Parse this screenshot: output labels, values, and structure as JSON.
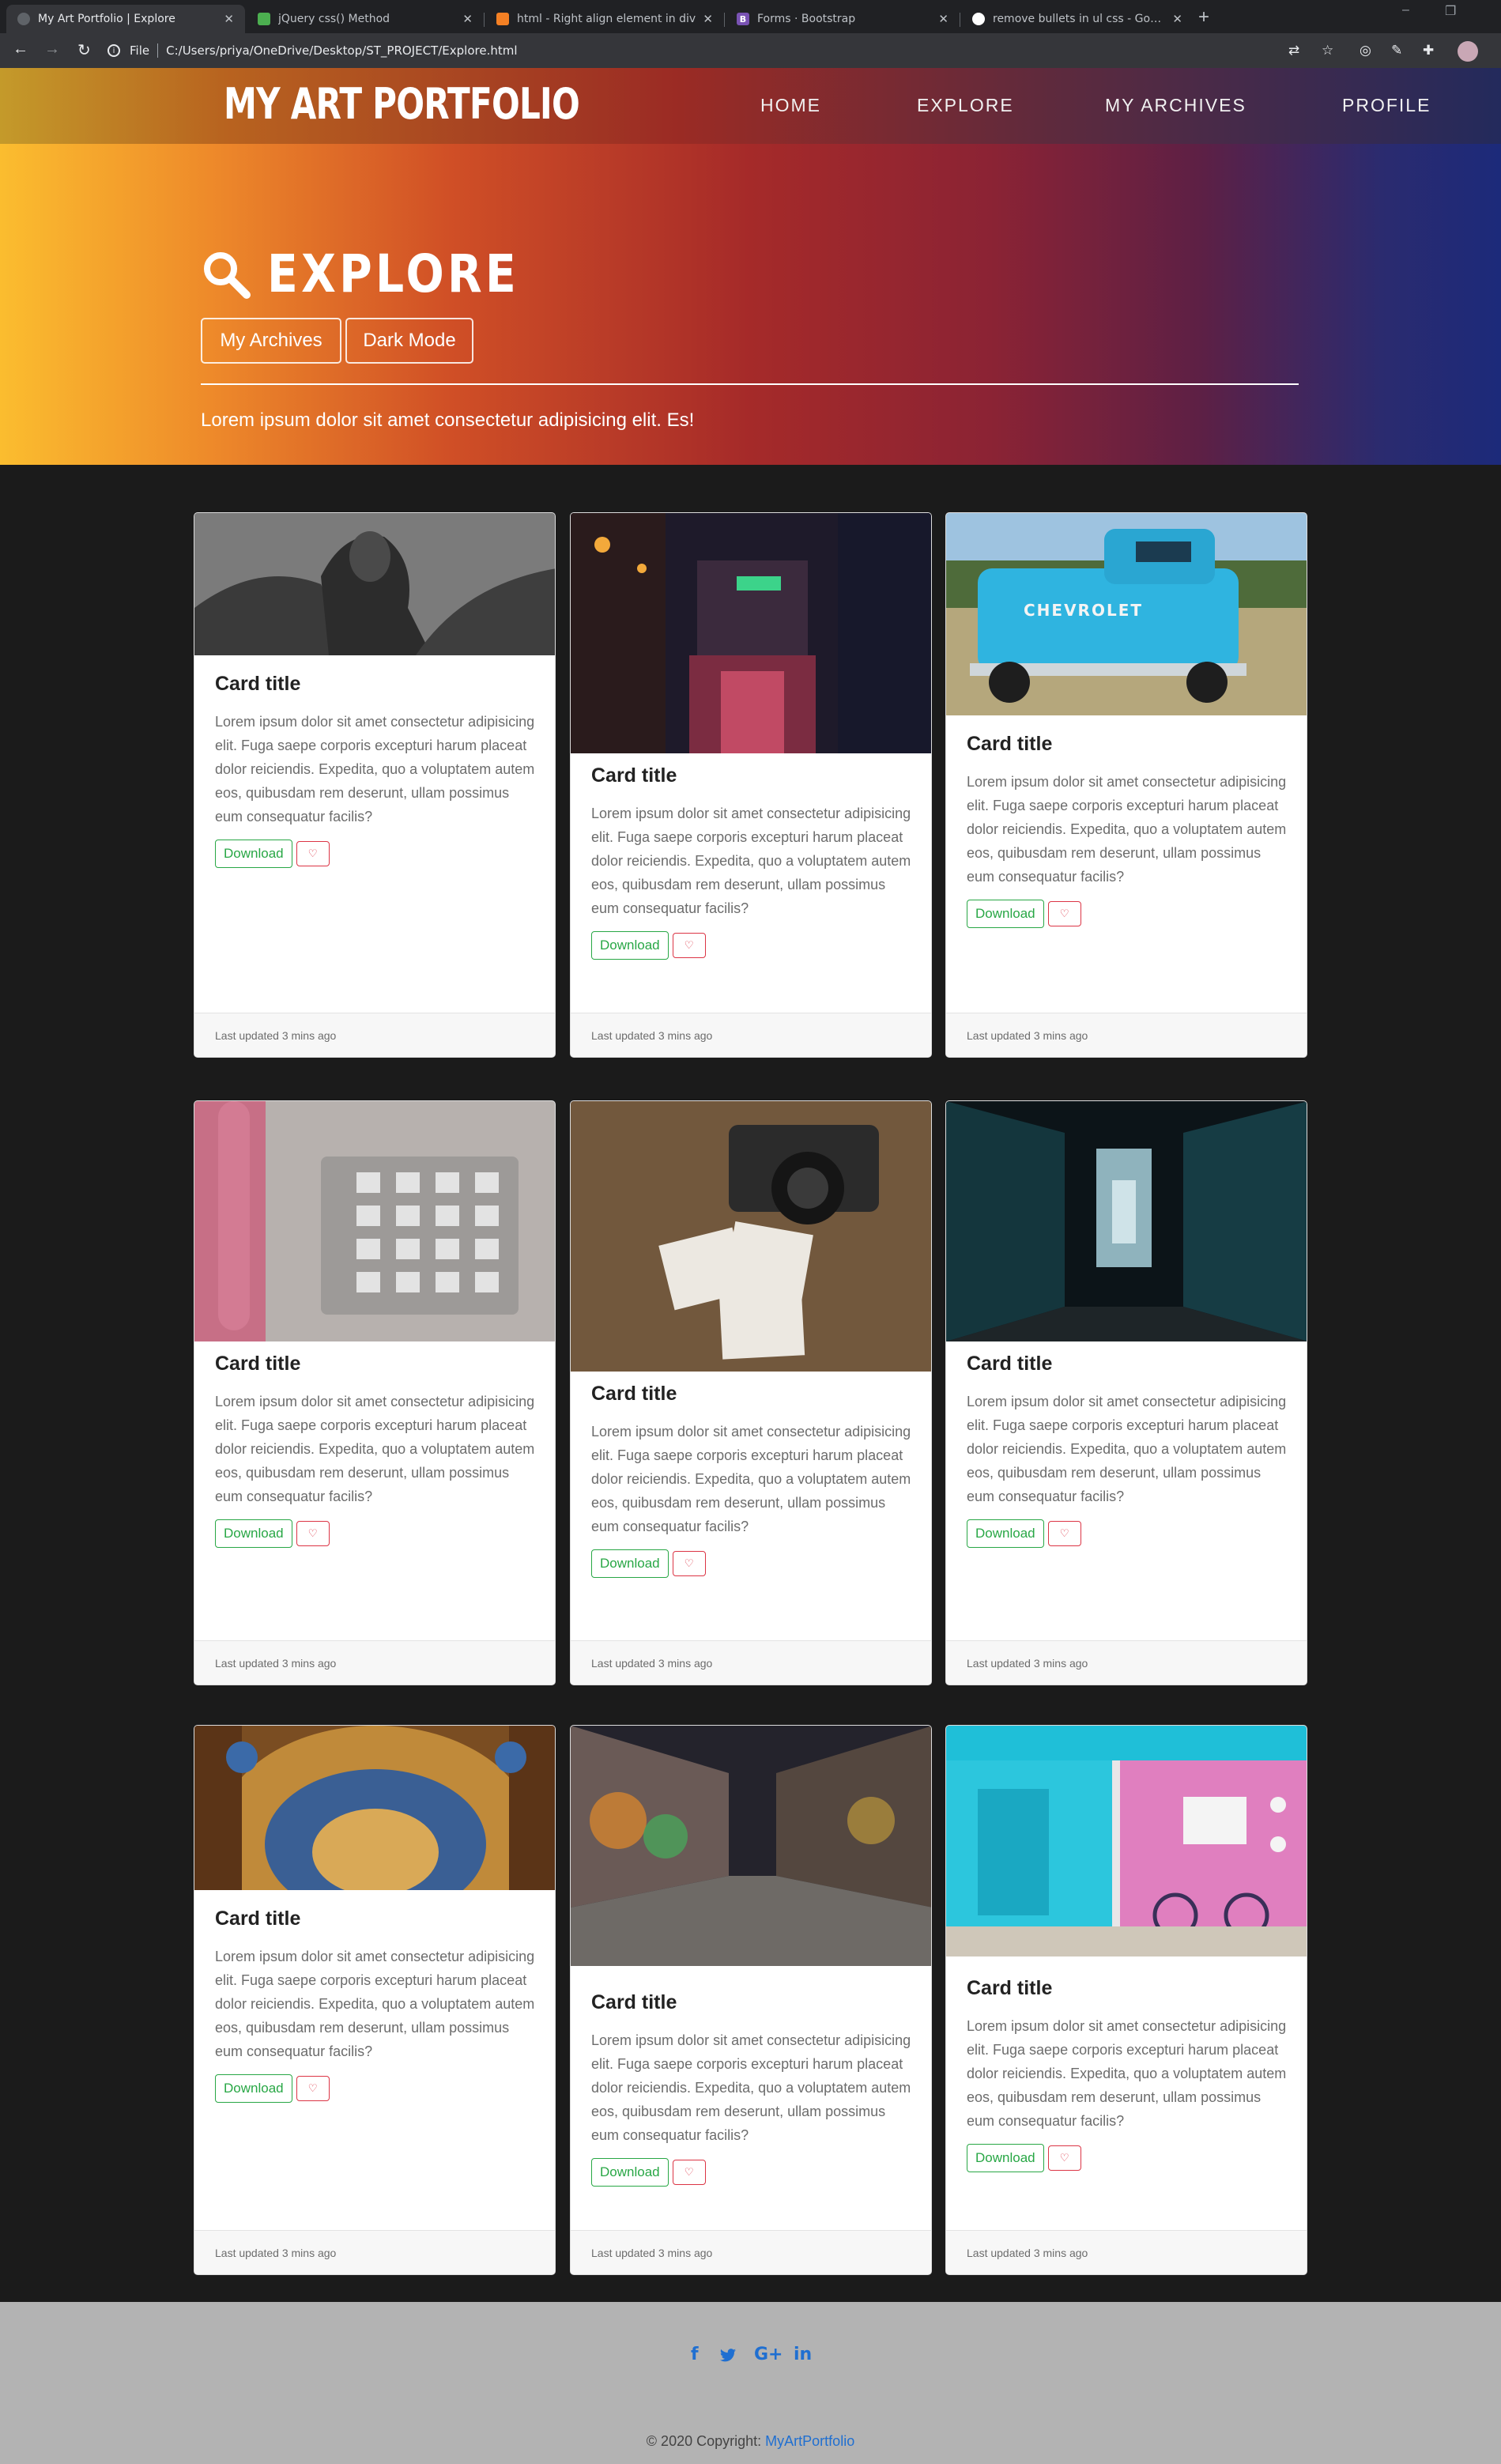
{
  "browser": {
    "tabs": [
      {
        "label": "My Art Portfolio | Explore",
        "favicon_color": "#5f6368",
        "active": true
      },
      {
        "label": "jQuery css() Method",
        "favicon_color": "#4caf50",
        "active": false
      },
      {
        "label": "html - Right align element in div",
        "favicon_color": "#f48024",
        "active": false
      },
      {
        "label": "Forms · Bootstrap",
        "favicon_color": "#7952b3",
        "active": false
      },
      {
        "label": "remove bullets in ul css - Google",
        "favicon_color": "#ffffff",
        "active": false
      }
    ],
    "address": {
      "scheme": "File",
      "path": "C:/Users/priya/OneDrive/Desktop/ST_PROJECT/Explore.html"
    }
  },
  "nav": {
    "brand": "MY ART PORTFOLIO",
    "links": [
      "HOME",
      "EXPLORE",
      "MY ARCHIVES",
      "PROFILE"
    ]
  },
  "hero": {
    "title": "EXPLORE",
    "buttons": [
      "My Archives",
      "Dark Mode"
    ],
    "lead": "Lorem ipsum dolor sit amet consectetur adipisicing elit. Es!"
  },
  "cards": [
    {
      "title": "Card title",
      "text": "Lorem ipsum dolor sit amet consectetur adipisicing elit. Fuga saepe corporis excepturi harum placeat dolor reiciendis. Expedita, quo a voluptatem autem eos, quibusdam rem deserunt, ullam possimus eum consequatur facilis?",
      "download_label": "Download",
      "footer": "Last updated 3 mins ago",
      "image": "angel-statue"
    },
    {
      "title": "Card title",
      "text": "Lorem ipsum dolor sit amet consectetur adipisicing elit. Fuga saepe corporis excepturi harum placeat dolor reiciendis. Expedita, quo a voluptatem autem eos, quibusdam rem deserunt, ullam possimus eum consequatur facilis?",
      "download_label": "Download",
      "footer": "Last updated 3 mins ago",
      "image": "neon-street"
    },
    {
      "title": "Card title",
      "text": "Lorem ipsum dolor sit amet consectetur adipisicing elit. Fuga saepe corporis excepturi harum placeat dolor reiciendis. Expedita, quo a voluptatem autem eos, quibusdam rem deserunt, ullam possimus eum consequatur facilis?",
      "download_label": "Download",
      "footer": "Last updated 3 mins ago",
      "image": "blue-truck",
      "image_text": "CHEVROLET"
    },
    {
      "title": "Card title",
      "text": "Lorem ipsum dolor sit amet consectetur adipisicing elit. Fuga saepe corporis excepturi harum placeat dolor reiciendis. Expedita, quo a voluptatem autem eos, quibusdam rem deserunt, ullam possimus eum consequatur facilis?",
      "download_label": "Download",
      "footer": "Last updated 3 mins ago",
      "image": "payphone"
    },
    {
      "title": "Card title",
      "text": "Lorem ipsum dolor sit amet consectetur adipisicing elit. Fuga saepe corporis excepturi harum placeat dolor reiciendis. Expedita, quo a voluptatem autem eos, quibusdam rem deserunt, ullam possimus eum consequatur facilis?",
      "download_label": "Download",
      "footer": "Last updated 3 mins ago",
      "image": "camera-photos"
    },
    {
      "title": "Card title",
      "text": "Lorem ipsum dolor sit amet consectetur adipisicing elit. Fuga saepe corporis excepturi harum placeat dolor reiciendis. Expedita, quo a voluptatem autem eos, quibusdam rem deserunt, ullam possimus eum consequatur facilis?",
      "download_label": "Download",
      "footer": "Last updated 3 mins ago",
      "image": "dark-corridor"
    },
    {
      "title": "Card title",
      "text": "Lorem ipsum dolor sit amet consectetur adipisicing elit. Fuga saepe corporis excepturi harum placeat dolor reiciendis. Expedita, quo a voluptatem autem eos, quibusdam rem deserunt, ullam possimus eum consequatur facilis?",
      "download_label": "Download",
      "footer": "Last updated 3 mins ago",
      "image": "ornate-ceiling"
    },
    {
      "title": "Card title",
      "text": "Lorem ipsum dolor sit amet consectetur adipisicing elit. Fuga saepe corporis excepturi harum placeat dolor reiciendis. Expedita, quo a voluptatem autem eos, quibusdam rem deserunt, ullam possimus eum consequatur facilis?",
      "download_label": "Download",
      "footer": "Last updated 3 mins ago",
      "image": "graffiti-alley"
    },
    {
      "title": "Card title",
      "text": "Lorem ipsum dolor sit amet consectetur adipisicing elit. Fuga saepe corporis excepturi harum placeat dolor reiciendis. Expedita, quo a voluptatem autem eos, quibusdam rem deserunt, ullam possimus eum consequatur facilis?",
      "download_label": "Download",
      "footer": "Last updated 3 mins ago",
      "image": "beach-huts"
    }
  ],
  "footer": {
    "social": [
      "f",
      "twitter-icon",
      "G+",
      "in"
    ],
    "copyright_prefix": "© 2020 Copyright:",
    "copyright_link": "MyArtPortfolio"
  },
  "colors": {
    "download": "#28a745",
    "like": "#dc3545",
    "link": "#1f6fd1"
  }
}
